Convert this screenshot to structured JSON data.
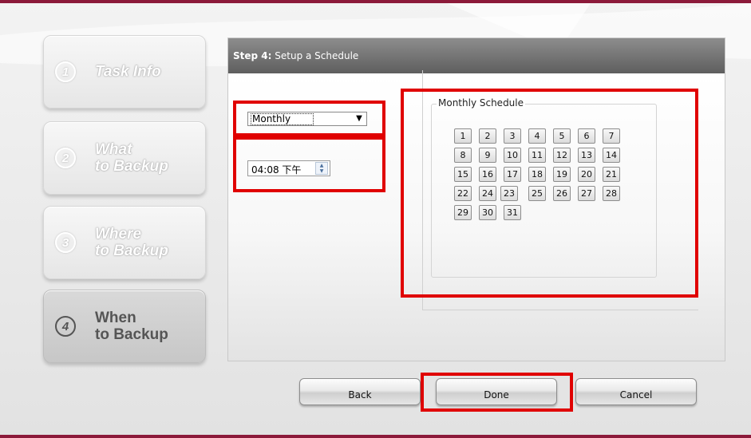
{
  "sidebar": {
    "steps": [
      {
        "num": "1",
        "label_line1": "Task Info",
        "label_line2": ""
      },
      {
        "num": "2",
        "label_line1": "What",
        "label_line2": "to Backup"
      },
      {
        "num": "3",
        "label_line1": "Where",
        "label_line2": "to Backup"
      },
      {
        "num": "4",
        "label_line1": "When",
        "label_line2": "to Backup"
      }
    ]
  },
  "panel": {
    "step_prefix": "Step 4:",
    "step_title": "Setup a Schedule"
  },
  "schedule": {
    "frequency_selected": "Monthly",
    "time_value": "04:08 下午",
    "monthly_legend": "Monthly Schedule",
    "days": [
      "1",
      "2",
      "3",
      "4",
      "5",
      "6",
      "7",
      "8",
      "9",
      "10",
      "11",
      "12",
      "13",
      "14",
      "15",
      "16",
      "17",
      "18",
      "19",
      "20",
      "21",
      "22",
      "24",
      "23",
      "25",
      "26",
      "27",
      "28",
      "29",
      "30",
      "31"
    ]
  },
  "buttons": {
    "back": "Back",
    "done": "Done",
    "cancel": "Cancel"
  },
  "colors": {
    "accent": "#8c1a3a",
    "highlight": "#e00000",
    "header": "#6e6e6e"
  }
}
